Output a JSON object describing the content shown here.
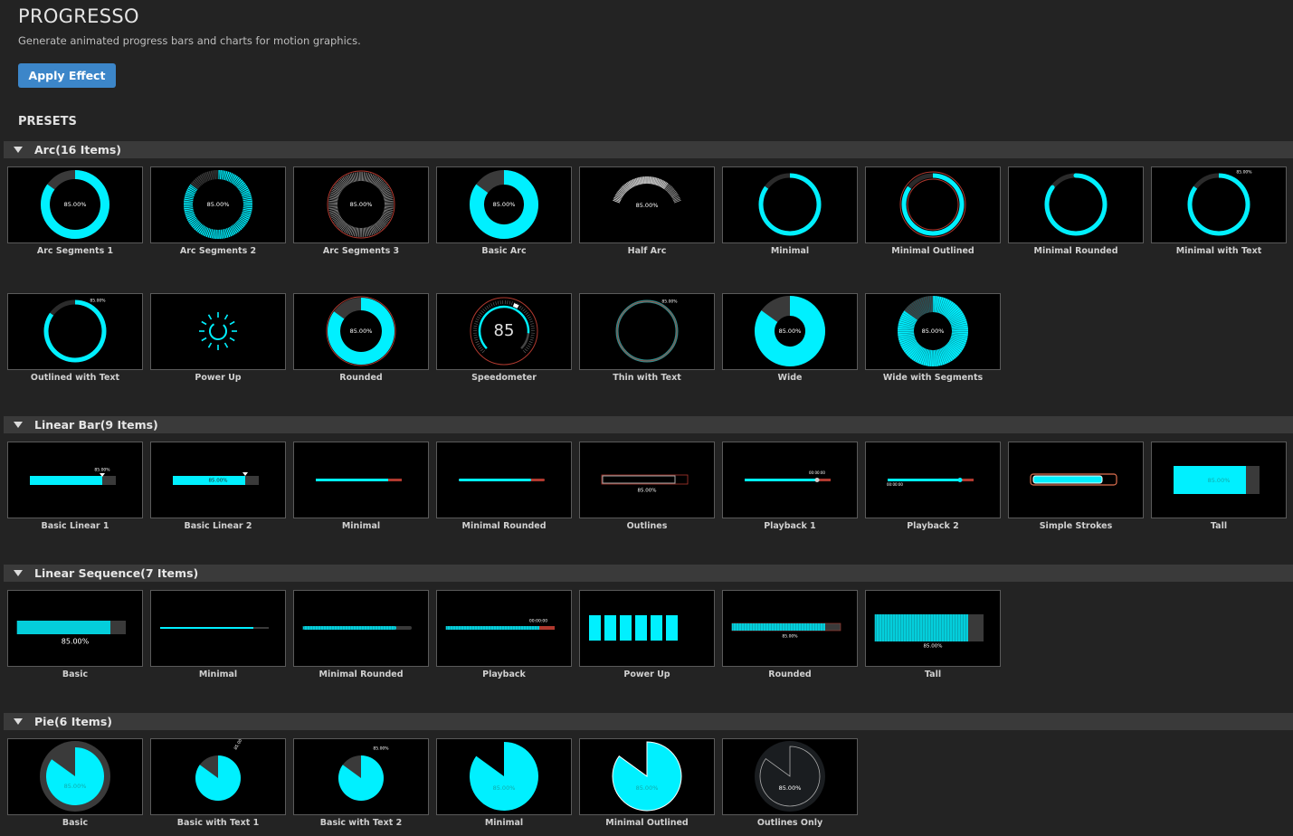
{
  "app": {
    "title": "PROGRESSO",
    "subtitle": "Generate animated progress bars and charts for motion graphics.",
    "apply_label": "Apply Effect",
    "presets_label": "PRESETS",
    "accent_color": "#00f0ff",
    "button_color": "#3c86c9"
  },
  "value_text": "85.00%",
  "speedo_text": "85",
  "time_text": "00:00:00",
  "categories": [
    {
      "name": "Arc",
      "count": "(16 Items)",
      "items": [
        {
          "label": "Arc Segments 1",
          "icon": "arc-segments-1"
        },
        {
          "label": "Arc Segments 2",
          "icon": "arc-segments-2"
        },
        {
          "label": "Arc Segments 3",
          "icon": "arc-segments-3"
        },
        {
          "label": "Basic Arc",
          "icon": "basic-arc"
        },
        {
          "label": "Half Arc",
          "icon": "half-arc"
        },
        {
          "label": "Minimal",
          "icon": "arc-minimal"
        },
        {
          "label": "Minimal Outlined",
          "icon": "arc-minimal-outlined"
        },
        {
          "label": "Minimal Rounded",
          "icon": "arc-minimal-rounded"
        },
        {
          "label": "Minimal with Text",
          "icon": "arc-minimal-text"
        },
        {
          "label": "Outlined with Text",
          "icon": "arc-outlined-text"
        },
        {
          "label": "Power Up",
          "icon": "arc-power-up"
        },
        {
          "label": "Rounded",
          "icon": "arc-rounded"
        },
        {
          "label": "Speedometer",
          "icon": "arc-speedometer"
        },
        {
          "label": "Thin with Text",
          "icon": "arc-thin-text"
        },
        {
          "label": "Wide",
          "icon": "arc-wide"
        },
        {
          "label": "Wide with Segments",
          "icon": "arc-wide-segments"
        }
      ]
    },
    {
      "name": "Linear Bar",
      "count": "(9 Items)",
      "items": [
        {
          "label": "Basic Linear 1",
          "icon": "linear-basic-1"
        },
        {
          "label": "Basic Linear 2",
          "icon": "linear-basic-2"
        },
        {
          "label": "Minimal",
          "icon": "linear-minimal"
        },
        {
          "label": "Minimal Rounded",
          "icon": "linear-minimal-rounded"
        },
        {
          "label": "Outlines",
          "icon": "linear-outlines"
        },
        {
          "label": "Playback 1",
          "icon": "linear-playback-1"
        },
        {
          "label": "Playback 2",
          "icon": "linear-playback-2"
        },
        {
          "label": "Simple Strokes",
          "icon": "linear-simple-strokes"
        },
        {
          "label": "Tall",
          "icon": "linear-tall"
        }
      ]
    },
    {
      "name": "Linear Sequence",
      "count": "(7 Items)",
      "items": [
        {
          "label": "Basic",
          "icon": "seq-basic"
        },
        {
          "label": "Minimal",
          "icon": "seq-minimal"
        },
        {
          "label": "Minimal Rounded",
          "icon": "seq-minimal-rounded"
        },
        {
          "label": "Playback",
          "icon": "seq-playback"
        },
        {
          "label": "Power Up",
          "icon": "seq-power-up"
        },
        {
          "label": "Rounded",
          "icon": "seq-rounded"
        },
        {
          "label": "Tall",
          "icon": "seq-tall"
        }
      ]
    },
    {
      "name": "Pie",
      "count": "(6 Items)",
      "items": [
        {
          "label": "Basic",
          "icon": "pie-basic"
        },
        {
          "label": "Basic with Text 1",
          "icon": "pie-text-1"
        },
        {
          "label": "Basic with Text 2",
          "icon": "pie-text-2"
        },
        {
          "label": "Minimal",
          "icon": "pie-minimal"
        },
        {
          "label": "Minimal Outlined",
          "icon": "pie-minimal-outlined"
        },
        {
          "label": "Outlines Only",
          "icon": "pie-outlines-only"
        }
      ]
    }
  ]
}
